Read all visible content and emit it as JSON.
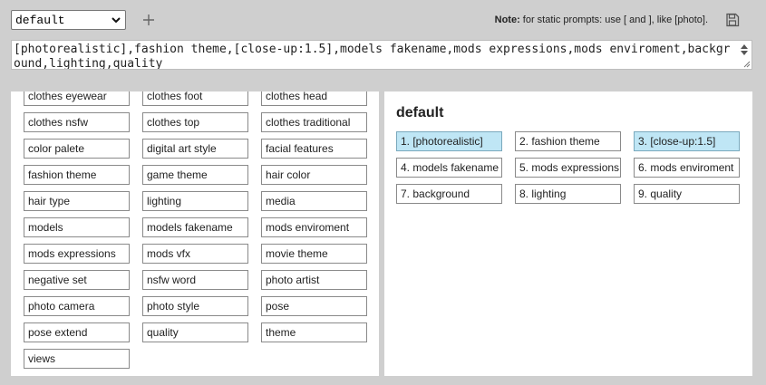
{
  "toolbar": {
    "preset_value": "default",
    "note_label": "Note:",
    "note_text": " for static prompts: use [ and ], like [photo]."
  },
  "prompt": {
    "text": "[photorealistic],fashion theme,[close-up:1.5],models fakename,mods expressions,mods enviroment,background,lighting,quality"
  },
  "categories": [
    "clothes eyewear",
    "clothes foot",
    "clothes head",
    "clothes nsfw",
    "clothes top",
    "clothes traditional",
    "color palete",
    "digital art style",
    "facial features",
    "fashion theme",
    "game theme",
    "hair color",
    "hair type",
    "lighting",
    "media",
    "models",
    "models fakename",
    "mods enviroment",
    "mods expressions",
    "mods vfx",
    "movie theme",
    "negative set",
    "nsfw word",
    "photo artist",
    "photo camera",
    "photo style",
    "pose",
    "pose extend",
    "quality",
    "theme",
    "views"
  ],
  "preset": {
    "title": "default",
    "slots": [
      {
        "label": "1. [photorealistic]",
        "active": true
      },
      {
        "label": "2. fashion theme",
        "active": false
      },
      {
        "label": "3. [close-up:1.5]",
        "active": true
      },
      {
        "label": "4. models fakename",
        "active": false
      },
      {
        "label": "5. mods expressions",
        "active": false
      },
      {
        "label": "6. mods enviroment",
        "active": false
      },
      {
        "label": "7. background",
        "active": false
      },
      {
        "label": "8. lighting",
        "active": false
      },
      {
        "label": "9. quality",
        "active": false
      }
    ]
  },
  "colors": {
    "active_slot": "#bfe6f5",
    "background": "#cfcfcf"
  },
  "icons": {
    "add": "plus-icon",
    "save": "floppy-disk-icon",
    "dropdown": "chevron-down-icon"
  }
}
